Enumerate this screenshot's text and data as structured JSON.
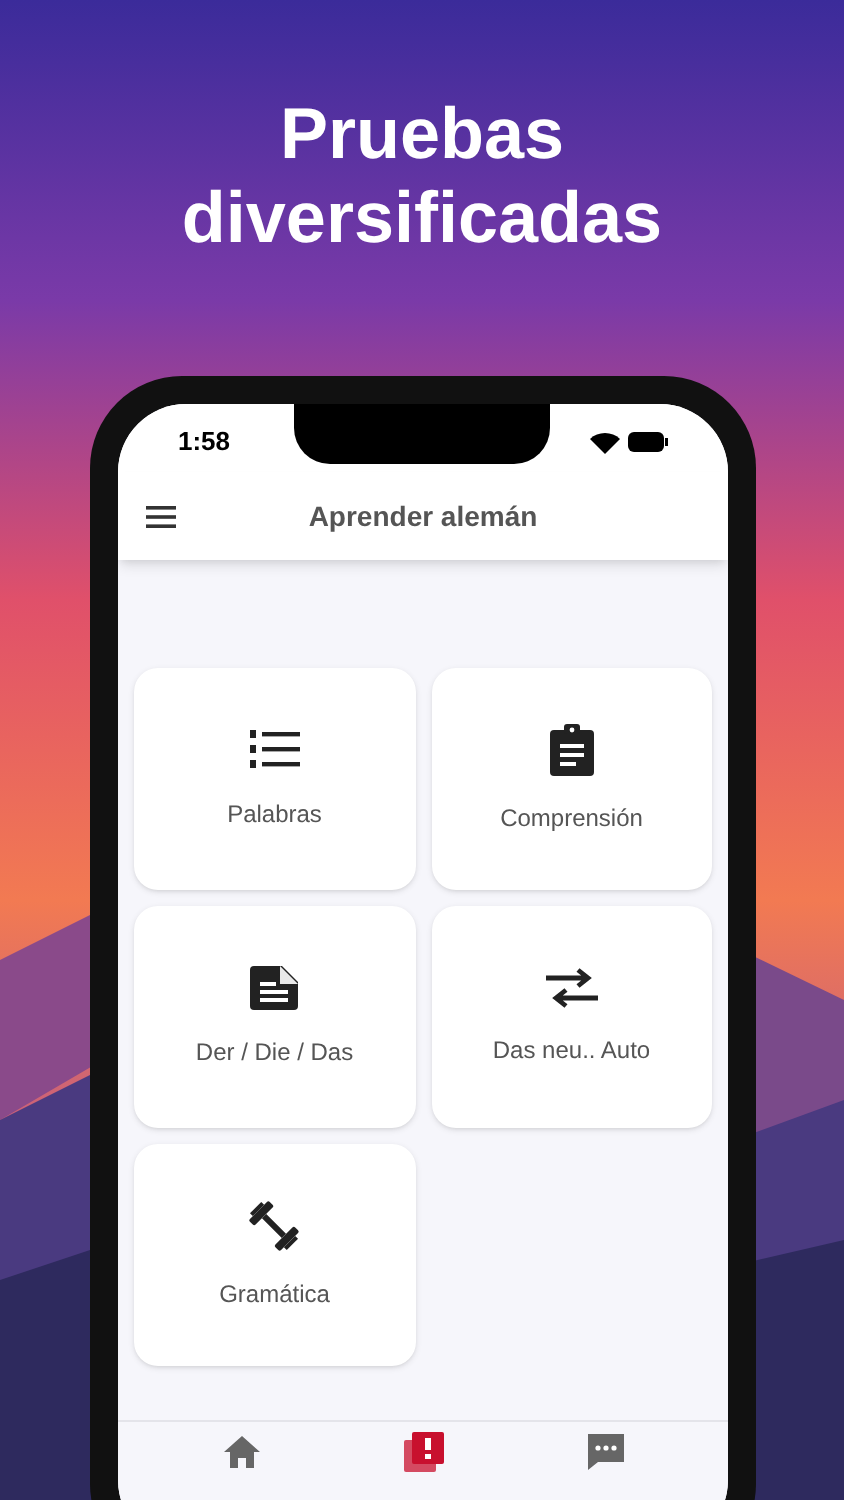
{
  "headline": "Pruebas diversificadas",
  "status_bar": {
    "time": "1:58"
  },
  "app_bar": {
    "title": "Aprender alemán"
  },
  "tiles": [
    {
      "label": "Palabras",
      "kind": "numbered-list"
    },
    {
      "label": "Comprensión",
      "kind": "clipboard"
    },
    {
      "label": "Der / Die / Das",
      "kind": "document"
    },
    {
      "label": "Das neu.. Auto",
      "kind": "swap"
    },
    {
      "label": "Gramática",
      "kind": "dumbbell"
    }
  ],
  "bottom_nav": [
    {
      "kind": "home",
      "selected": false
    },
    {
      "kind": "quiz",
      "selected": true
    },
    {
      "kind": "chat",
      "selected": false
    }
  ]
}
